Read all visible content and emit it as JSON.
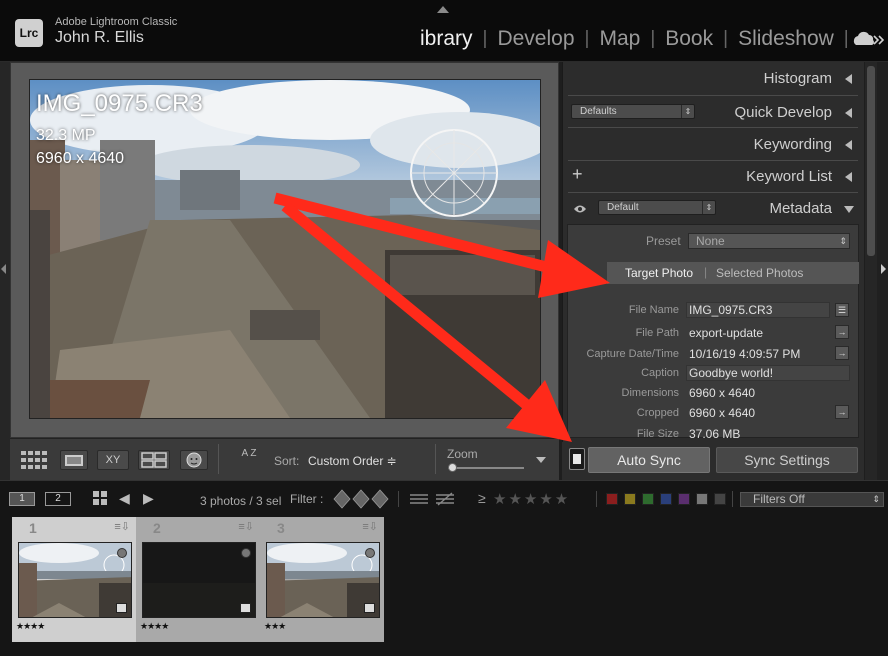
{
  "app": {
    "logo_text": "Lrc",
    "app_name": "Adobe Lightroom Classic",
    "user_name": "John R. Ellis"
  },
  "modules": [
    {
      "label": "ibrary",
      "active": true
    },
    {
      "label": "Develop"
    },
    {
      "label": "Map"
    },
    {
      "label": "Book"
    },
    {
      "label": "Slideshow"
    }
  ],
  "module_separator": "|",
  "loupe": {
    "file_name": "IMG_0975.CR3",
    "megapixels": "32.3 MP",
    "dimensions": "6960 x 4640"
  },
  "toolbar": {
    "sort_label": "Sort:",
    "sort_value": "Custom Order ≑",
    "zoom_label": "Zoom",
    "zoom_level": 0.05,
    "compare_label": "XY",
    "sort_icon_text": "A Z"
  },
  "right_panel": {
    "histogram": "Histogram",
    "quick_develop": "Quick Develop",
    "quick_develop_preset": "Defaults",
    "keywording": "Keywording",
    "keyword_list": "Keyword List",
    "keyword_add": "+",
    "metadata": "Metadata",
    "metadata_preset": "Default",
    "preset_label": "Preset",
    "preset_value": "None",
    "target_photo": "Target Photo",
    "toggle_separator": "|",
    "selected_photos": "Selected Photos",
    "fields": [
      {
        "label": "File Name",
        "value": "IMG_0975.CR3"
      },
      {
        "label": "File Path",
        "value": "export-update"
      },
      {
        "label": "Capture Date/Time",
        "value": "10/16/19 4:09:57 PM"
      },
      {
        "label": "Caption",
        "value": "Goodbye world!"
      },
      {
        "label": "Dimensions",
        "value": "6960 x 4640"
      },
      {
        "label": "Cropped",
        "value": "6960 x 4640"
      },
      {
        "label": "File Size",
        "value": "37.06 MB"
      }
    ]
  },
  "sync": {
    "auto_sync": "Auto Sync",
    "sync_settings": "Sync Settings"
  },
  "filmstrip_header": {
    "view1": "1",
    "view2": "2",
    "photo_count": "3 photos / 3 sel",
    "filter_label": "Filter :",
    "rating_op": "≥",
    "rating_stars": "★★★★★",
    "filters_value": "Filters Off",
    "color_labels": [
      "#8b1e1e",
      "#8a7a1e",
      "#2e6b2e",
      "#2a3f7a",
      "#5a2e6e",
      "#777777",
      "#444444"
    ]
  },
  "filmstrip": [
    {
      "num": "1",
      "stars": "★★★★",
      "dark": false
    },
    {
      "num": "2",
      "stars": "★★★★",
      "dark": true
    },
    {
      "num": "3",
      "stars": "★★★",
      "dark": false
    }
  ],
  "colors": {
    "arrow": "#ff2a1a",
    "active_cell": "#cfcfcf",
    "inactive_cell": "#a9a9a9"
  }
}
